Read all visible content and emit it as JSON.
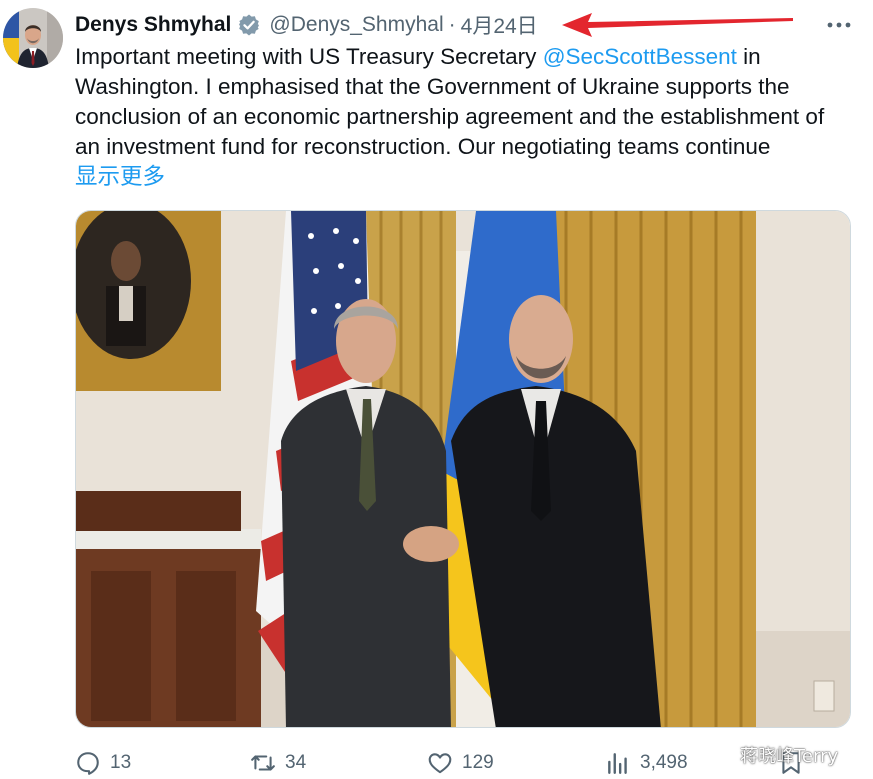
{
  "tweet": {
    "author": {
      "display_name": "Denys Shmyhal",
      "handle": "@Denys_Shmyhal",
      "verified_icon": "verified-badge-icon"
    },
    "separator": "·",
    "date": "4月24日",
    "text": {
      "part1": "Important meeting with US Treasury Secretary ",
      "mention": "@SecScottBessent",
      "part2": " in Washington. I emphasised that the Government of Ukraine supports the conclusion of an economic partnership agreement and the establishment of an investment fund for reconstruction. Our negotiating teams continue"
    },
    "show_more": "显示更多",
    "media": {
      "description_icon": "photo-two-men-handshake-flags-icon"
    },
    "actions": {
      "replies": "13",
      "reposts": "34",
      "likes": "129",
      "views": "3,498"
    }
  },
  "watermark": "蒋晓峰Terry",
  "colors": {
    "link": "#1d9bf0",
    "secondary_text": "#536471",
    "primary_text": "#0f1419",
    "annotation_arrow": "#e3262e"
  }
}
